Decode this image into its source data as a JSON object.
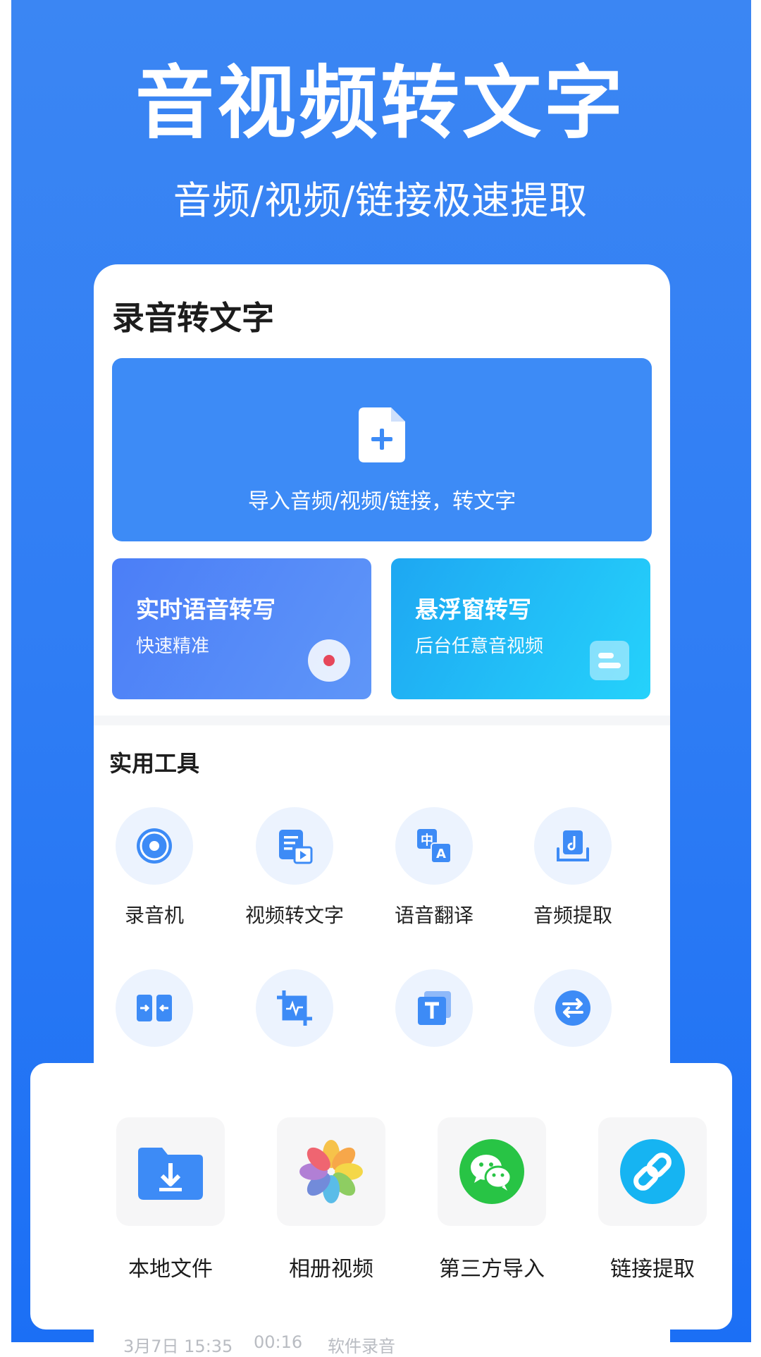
{
  "header": {
    "title": "音视频转文字",
    "subtitle": "音频/视频/链接极速提取"
  },
  "app": {
    "section_title": "录音转文字",
    "import_card": {
      "label": "导入音频/视频/链接，转文字",
      "icon": "file-plus-icon"
    },
    "realtime_card": {
      "title": "实时语音转写",
      "subtitle": "快速精准",
      "icon": "record-icon"
    },
    "floating_card": {
      "title": "悬浮窗转写",
      "subtitle": "后台任意音视频",
      "icon": "float-window-icon"
    },
    "tools_title": "实用工具",
    "tools": [
      {
        "label": "录音机",
        "icon": "recorder-icon"
      },
      {
        "label": "视频转文字",
        "icon": "video-to-text-icon"
      },
      {
        "label": "语音翻译",
        "icon": "translate-icon"
      },
      {
        "label": "音频提取",
        "icon": "audio-extract-icon"
      },
      {
        "label": "",
        "icon": "merge-icon"
      },
      {
        "label": "",
        "icon": "crop-audio-icon"
      },
      {
        "label": "",
        "icon": "text-icon"
      },
      {
        "label": "",
        "icon": "convert-icon"
      }
    ],
    "recent_record": {
      "date": "3月7日 15:35",
      "duration": "00:16",
      "source": "软件录音"
    }
  },
  "import_sheet": {
    "options": [
      {
        "label": "本地文件",
        "icon": "folder-download-icon"
      },
      {
        "label": "相册视频",
        "icon": "photos-icon"
      },
      {
        "label": "第三方导入",
        "icon": "wechat-icon"
      },
      {
        "label": "链接提取",
        "icon": "link-icon"
      }
    ]
  },
  "colors": {
    "brand_blue": "#2f7df4",
    "card_blue": "#3d8bf6",
    "cyan": "#1ea7f2",
    "record_red": "#e6475a",
    "wechat_green": "#28c445",
    "link_cyan": "#16b4f2"
  }
}
